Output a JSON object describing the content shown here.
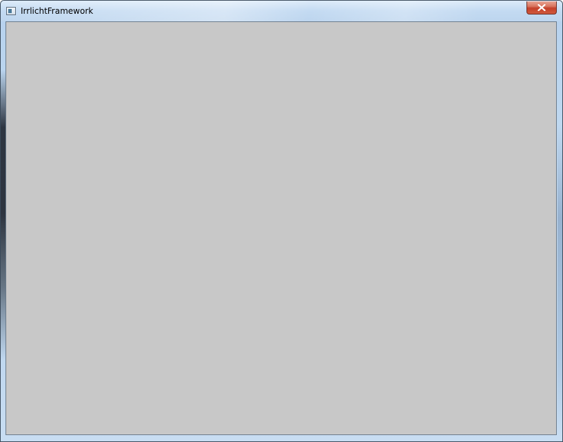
{
  "window": {
    "title": "IrrlichtFramework",
    "icon": "application-window-icon",
    "close_icon": "close-x-icon"
  },
  "client_area": {
    "background_color": "#c8c8c8"
  },
  "colors": {
    "close_button": "#c4402a",
    "frame": "#bcd6ef"
  }
}
